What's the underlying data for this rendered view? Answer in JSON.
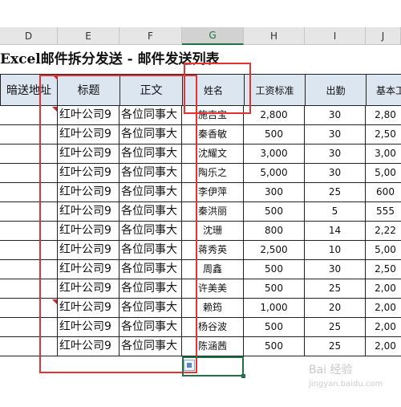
{
  "column_headers": [
    "D",
    "E",
    "F",
    "G",
    "H",
    "I",
    "J"
  ],
  "selected_column": "G",
  "sheet_title": "Excel邮件拆分发送 - 邮件发送列表",
  "table_headers": [
    "暗送地址",
    "标题",
    "正文",
    "姓名",
    "工资标准",
    "出勤",
    "基本工"
  ],
  "rows": [
    {
      "title": "红叶公司9",
      "body": "各位同事大",
      "name": "施吉宝",
      "wage": "2,800",
      "att": "30",
      "base": "2,80"
    },
    {
      "title": "红叶公司9",
      "body": "各位同事大",
      "name": "秦香敏",
      "wage": "500",
      "att": "30",
      "base": "2,50"
    },
    {
      "title": "红叶公司9",
      "body": "各位同事大",
      "name": "沈耀文",
      "wage": "3,000",
      "att": "30",
      "base": "3,00"
    },
    {
      "title": "红叶公司9",
      "body": "各位同事大",
      "name": "陶乐之",
      "wage": "5,000",
      "att": "30",
      "base": "5,00"
    },
    {
      "title": "红叶公司9",
      "body": "各位同事大",
      "name": "李伊萍",
      "wage": "300",
      "att": "25",
      "base": "600"
    },
    {
      "title": "红叶公司9",
      "body": "各位同事大",
      "name": "秦洪丽",
      "wage": "500",
      "att": "5",
      "base": "555"
    },
    {
      "title": "红叶公司9",
      "body": "各位同事大",
      "name": "沈珊",
      "wage": "800",
      "att": "14",
      "base": "2,22"
    },
    {
      "title": "红叶公司9",
      "body": "各位同事大",
      "name": "蒋秀英",
      "wage": "2,500",
      "att": "10",
      "base": "5,00"
    },
    {
      "title": "红叶公司9",
      "body": "各位同事大",
      "name": "周鑫",
      "wage": "500",
      "att": "30",
      "base": "2,50"
    },
    {
      "title": "红叶公司9",
      "body": "各位同事大",
      "name": "许美美",
      "wage": "500",
      "att": "25",
      "base": "2,00"
    },
    {
      "title": "红叶公司9",
      "body": "各位同事大",
      "name": "赖筠",
      "wage": "1,000",
      "att": "20",
      "base": "2,00"
    },
    {
      "title": "红叶公司9",
      "body": "各位同事大",
      "name": "杨谷波",
      "wage": "500",
      "att": "25",
      "base": "2,00"
    },
    {
      "title": "红叶公司9",
      "body": "各位同事大",
      "name": "陈涵茜",
      "wage": "500",
      "att": "25",
      "base": "2,00"
    }
  ],
  "watermark": {
    "line1": "Bai 经验",
    "line2": "jingyan.baidu.com"
  }
}
